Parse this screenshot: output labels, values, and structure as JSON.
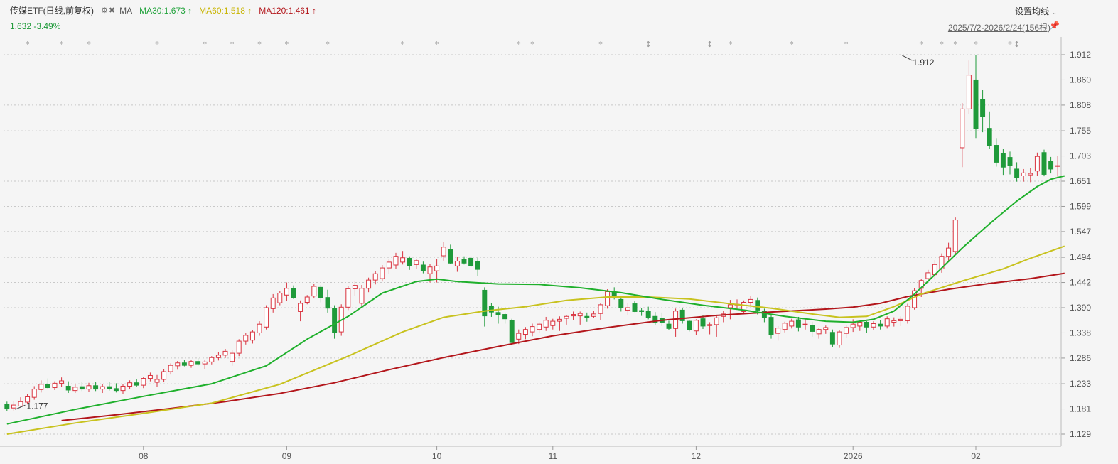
{
  "header": {
    "title": "传媒ETF(日线,前复权)",
    "indicator": "MA",
    "ma30_label": "MA30:1.673",
    "ma30_arrow": "↑",
    "ma60_label": "MA60:1.518",
    "ma60_arrow": "↑",
    "ma120_label": "MA120:1.461",
    "ma120_arrow": "↑",
    "price_line": "1.632  -3.49%",
    "settings_label": "设置均线",
    "date_range": "2025/7/2-2026/2/24(156根)"
  },
  "colors": {
    "up": "#d9333f",
    "down": "#1f9a3a",
    "ma30": "#1fb02c",
    "ma60": "#c8c21e",
    "ma120": "#b3161b",
    "grid": "#c8c8c8"
  },
  "icons": [
    "gear-icon",
    "close-circle-icon",
    "chevron-down-icon",
    "pin-icon",
    "star-icon"
  ],
  "chart_data": {
    "type": "candlestick",
    "y_axis": {
      "ticks": [
        "1.912",
        "1.860",
        "1.808",
        "1.755",
        "1.703",
        "1.651",
        "1.599",
        "1.547",
        "1.494",
        "1.442",
        "1.390",
        "1.338",
        "1.286",
        "1.233",
        "1.181",
        "1.129"
      ],
      "min": 1.129,
      "max": 1.912
    },
    "x_axis_labels": [
      {
        "label": "08",
        "index": 20
      },
      {
        "label": "09",
        "index": 41
      },
      {
        "label": "10",
        "index": 63
      },
      {
        "label": "11",
        "index": 80
      },
      {
        "label": "12",
        "index": 101
      },
      {
        "label": "2026",
        "index": 124
      },
      {
        "label": "02",
        "index": 142
      }
    ],
    "annotations": [
      {
        "text": "1.912",
        "index": 131,
        "value": 1.912,
        "kind": "high"
      },
      {
        "text": "1.177",
        "index": 1,
        "value": 1.177,
        "kind": "low"
      }
    ],
    "event_markers": [
      {
        "index": 3,
        "symbol": "*"
      },
      {
        "index": 8,
        "symbol": "*"
      },
      {
        "index": 12,
        "symbol": "*"
      },
      {
        "index": 22,
        "symbol": "*"
      },
      {
        "index": 29,
        "symbol": "*"
      },
      {
        "index": 33,
        "symbol": "*"
      },
      {
        "index": 37,
        "symbol": "*"
      },
      {
        "index": 41,
        "symbol": "*"
      },
      {
        "index": 47,
        "symbol": "*"
      },
      {
        "index": 58,
        "symbol": "*"
      },
      {
        "index": 63,
        "symbol": "*"
      },
      {
        "index": 75,
        "symbol": "*"
      },
      {
        "index": 77,
        "symbol": "*"
      },
      {
        "index": 87,
        "symbol": "*"
      },
      {
        "index": 94,
        "symbol": "↕"
      },
      {
        "index": 103,
        "symbol": "↕"
      },
      {
        "index": 106,
        "symbol": "*"
      },
      {
        "index": 115,
        "symbol": "*"
      },
      {
        "index": 123,
        "symbol": "*"
      },
      {
        "index": 134,
        "symbol": "*"
      },
      {
        "index": 137,
        "symbol": "*"
      },
      {
        "index": 139,
        "symbol": "*"
      },
      {
        "index": 142,
        "symbol": "*"
      },
      {
        "index": 147,
        "symbol": "*"
      },
      {
        "index": 148,
        "symbol": "↕"
      }
    ],
    "candles": [
      [
        1.19,
        1.196,
        1.176,
        1.181
      ],
      [
        1.183,
        1.198,
        1.177,
        1.189
      ],
      [
        1.187,
        1.205,
        1.184,
        1.196
      ],
      [
        1.195,
        1.212,
        1.191,
        1.206
      ],
      [
        1.205,
        1.228,
        1.2,
        1.222
      ],
      [
        1.221,
        1.24,
        1.215,
        1.232
      ],
      [
        1.232,
        1.244,
        1.222,
        1.225
      ],
      [
        1.225,
        1.238,
        1.22,
        1.234
      ],
      [
        1.234,
        1.246,
        1.226,
        1.239
      ],
      [
        1.228,
        1.238,
        1.214,
        1.22
      ],
      [
        1.219,
        1.232,
        1.214,
        1.226
      ],
      [
        1.227,
        1.236,
        1.218,
        1.222
      ],
      [
        1.222,
        1.235,
        1.216,
        1.229
      ],
      [
        1.229,
        1.236,
        1.218,
        1.222
      ],
      [
        1.222,
        1.233,
        1.214,
        1.227
      ],
      [
        1.227,
        1.236,
        1.219,
        1.223
      ],
      [
        1.223,
        1.234,
        1.215,
        1.219
      ],
      [
        1.219,
        1.232,
        1.212,
        1.228
      ],
      [
        1.228,
        1.24,
        1.222,
        1.235
      ],
      [
        1.235,
        1.243,
        1.226,
        1.23
      ],
      [
        1.23,
        1.247,
        1.224,
        1.244
      ],
      [
        1.244,
        1.256,
        1.238,
        1.25
      ],
      [
        1.236,
        1.251,
        1.227,
        1.242
      ],
      [
        1.242,
        1.263,
        1.236,
        1.258
      ],
      [
        1.258,
        1.275,
        1.252,
        1.271
      ],
      [
        1.27,
        1.28,
        1.262,
        1.276
      ],
      [
        1.276,
        1.282,
        1.269,
        1.271
      ],
      [
        1.271,
        1.283,
        1.266,
        1.279
      ],
      [
        1.279,
        1.286,
        1.27,
        1.274
      ],
      [
        1.274,
        1.283,
        1.263,
        1.278
      ],
      [
        1.278,
        1.29,
        1.273,
        1.287
      ],
      [
        1.287,
        1.298,
        1.281,
        1.292
      ],
      [
        1.292,
        1.305,
        1.286,
        1.3
      ],
      [
        1.279,
        1.302,
        1.27,
        1.296
      ],
      [
        1.296,
        1.325,
        1.29,
        1.321
      ],
      [
        1.321,
        1.338,
        1.314,
        1.333
      ],
      [
        1.323,
        1.344,
        1.316,
        1.34
      ],
      [
        1.338,
        1.362,
        1.332,
        1.356
      ],
      [
        1.35,
        1.395,
        1.345,
        1.39
      ],
      [
        1.388,
        1.418,
        1.38,
        1.41
      ],
      [
        1.4,
        1.424,
        1.395,
        1.42
      ],
      [
        1.416,
        1.442,
        1.404,
        1.43
      ],
      [
        1.43,
        1.436,
        1.408,
        1.411
      ],
      [
        1.382,
        1.405,
        1.362,
        1.399
      ],
      [
        1.401,
        1.416,
        1.397,
        1.412
      ],
      [
        1.414,
        1.439,
        1.409,
        1.434
      ],
      [
        1.432,
        1.437,
        1.401,
        1.41
      ],
      [
        1.411,
        1.427,
        1.38,
        1.389
      ],
      [
        1.389,
        1.395,
        1.326,
        1.338
      ],
      [
        1.34,
        1.397,
        1.332,
        1.391
      ],
      [
        1.391,
        1.434,
        1.385,
        1.429
      ],
      [
        1.429,
        1.444,
        1.415,
        1.436
      ],
      [
        1.399,
        1.437,
        1.391,
        1.43
      ],
      [
        1.43,
        1.452,
        1.422,
        1.447
      ],
      [
        1.447,
        1.466,
        1.438,
        1.46
      ],
      [
        1.45,
        1.478,
        1.444,
        1.472
      ],
      [
        1.472,
        1.49,
        1.46,
        1.484
      ],
      [
        1.478,
        1.503,
        1.47,
        1.496
      ],
      [
        1.484,
        1.507,
        1.479,
        1.493
      ],
      [
        1.492,
        1.496,
        1.468,
        1.476
      ],
      [
        1.479,
        1.491,
        1.47,
        1.487
      ],
      [
        1.478,
        1.485,
        1.461,
        1.467
      ],
      [
        1.46,
        1.48,
        1.442,
        1.474
      ],
      [
        1.466,
        1.49,
        1.442,
        1.476
      ],
      [
        1.497,
        1.525,
        1.487,
        1.515
      ],
      [
        1.51,
        1.52,
        1.48,
        1.482
      ],
      [
        1.476,
        1.495,
        1.464,
        1.486
      ],
      [
        1.489,
        1.496,
        1.479,
        1.482
      ],
      [
        1.492,
        1.496,
        1.474,
        1.476
      ],
      [
        1.486,
        1.493,
        1.456,
        1.469
      ],
      [
        1.426,
        1.432,
        1.351,
        1.373
      ],
      [
        1.393,
        1.4,
        1.371,
        1.381
      ],
      [
        1.38,
        1.392,
        1.357,
        1.376
      ],
      [
        1.376,
        1.38,
        1.357,
        1.367
      ],
      [
        1.363,
        1.367,
        1.313,
        1.318
      ],
      [
        1.325,
        1.345,
        1.315,
        1.337
      ],
      [
        1.335,
        1.35,
        1.325,
        1.345
      ],
      [
        1.34,
        1.357,
        1.331,
        1.351
      ],
      [
        1.345,
        1.36,
        1.338,
        1.356
      ],
      [
        1.35,
        1.371,
        1.342,
        1.364
      ],
      [
        1.353,
        1.367,
        1.345,
        1.362
      ],
      [
        1.362,
        1.372,
        1.342,
        1.366
      ],
      [
        1.368,
        1.375,
        1.355,
        1.372
      ],
      [
        1.373,
        1.382,
        1.364,
        1.376
      ],
      [
        1.373,
        1.382,
        1.355,
        1.378
      ],
      [
        1.372,
        1.38,
        1.361,
        1.37
      ],
      [
        1.372,
        1.384,
        1.368,
        1.377
      ],
      [
        1.378,
        1.399,
        1.364,
        1.396
      ],
      [
        1.394,
        1.428,
        1.388,
        1.423
      ],
      [
        1.422,
        1.432,
        1.407,
        1.41
      ],
      [
        1.407,
        1.412,
        1.382,
        1.39
      ],
      [
        1.385,
        1.399,
        1.374,
        1.39
      ],
      [
        1.398,
        1.403,
        1.381,
        1.382
      ],
      [
        1.384,
        1.389,
        1.373,
        1.382
      ],
      [
        1.382,
        1.392,
        1.366,
        1.369
      ],
      [
        1.372,
        1.381,
        1.355,
        1.359
      ],
      [
        1.368,
        1.38,
        1.352,
        1.36
      ],
      [
        1.356,
        1.363,
        1.344,
        1.347
      ],
      [
        1.347,
        1.388,
        1.33,
        1.383
      ],
      [
        1.385,
        1.39,
        1.357,
        1.363
      ],
      [
        1.362,
        1.365,
        1.341,
        1.345
      ],
      [
        1.342,
        1.366,
        1.333,
        1.364
      ],
      [
        1.367,
        1.375,
        1.346,
        1.352
      ],
      [
        1.353,
        1.36,
        1.335,
        1.355
      ],
      [
        1.355,
        1.375,
        1.33,
        1.369
      ],
      [
        1.372,
        1.383,
        1.36,
        1.377
      ],
      [
        1.39,
        1.406,
        1.366,
        1.396
      ],
      [
        1.396,
        1.407,
        1.388,
        1.397
      ],
      [
        1.382,
        1.405,
        1.376,
        1.401
      ],
      [
        1.401,
        1.414,
        1.393,
        1.407
      ],
      [
        1.405,
        1.411,
        1.376,
        1.385
      ],
      [
        1.382,
        1.388,
        1.36,
        1.37
      ],
      [
        1.37,
        1.375,
        1.326,
        1.335
      ],
      [
        1.337,
        1.352,
        1.322,
        1.348
      ],
      [
        1.345,
        1.361,
        1.339,
        1.358
      ],
      [
        1.352,
        1.367,
        1.347,
        1.362
      ],
      [
        1.365,
        1.371,
        1.341,
        1.35
      ],
      [
        1.355,
        1.366,
        1.345,
        1.356
      ],
      [
        1.354,
        1.361,
        1.33,
        1.341
      ],
      [
        1.336,
        1.348,
        1.326,
        1.345
      ],
      [
        1.345,
        1.353,
        1.336,
        1.349
      ],
      [
        1.339,
        1.345,
        1.308,
        1.315
      ],
      [
        1.313,
        1.344,
        1.307,
        1.34
      ],
      [
        1.337,
        1.354,
        1.327,
        1.349
      ],
      [
        1.349,
        1.366,
        1.34,
        1.356
      ],
      [
        1.352,
        1.362,
        1.342,
        1.36
      ],
      [
        1.36,
        1.362,
        1.338,
        1.35
      ],
      [
        1.35,
        1.362,
        1.343,
        1.357
      ],
      [
        1.356,
        1.364,
        1.345,
        1.352
      ],
      [
        1.352,
        1.372,
        1.347,
        1.367
      ],
      [
        1.36,
        1.37,
        1.351,
        1.363
      ],
      [
        1.363,
        1.372,
        1.352,
        1.366
      ],
      [
        1.363,
        1.398,
        1.357,
        1.393
      ],
      [
        1.39,
        1.431,
        1.386,
        1.425
      ],
      [
        1.43,
        1.449,
        1.412,
        1.446
      ],
      [
        1.45,
        1.468,
        1.444,
        1.462
      ],
      [
        1.458,
        1.488,
        1.448,
        1.479
      ],
      [
        1.47,
        1.502,
        1.462,
        1.496
      ],
      [
        1.496,
        1.524,
        1.484,
        1.513
      ],
      [
        1.506,
        1.576,
        1.5,
        1.571
      ],
      [
        1.72,
        1.812,
        1.68,
        1.8
      ],
      [
        1.8,
        1.9,
        1.79,
        1.87
      ],
      [
        1.86,
        1.912,
        1.74,
        1.76
      ],
      [
        1.82,
        1.84,
        1.752,
        1.785
      ],
      [
        1.76,
        1.795,
        1.718,
        1.725
      ],
      [
        1.725,
        1.74,
        1.681,
        1.69
      ],
      [
        1.708,
        1.718,
        1.664,
        1.68
      ],
      [
        1.7,
        1.712,
        1.665,
        1.684
      ],
      [
        1.676,
        1.69,
        1.65,
        1.658
      ],
      [
        1.662,
        1.676,
        1.65,
        1.668
      ],
      [
        1.664,
        1.678,
        1.649,
        1.667
      ],
      [
        1.672,
        1.71,
        1.662,
        1.702
      ],
      [
        1.71,
        1.716,
        1.661,
        1.665
      ],
      [
        1.692,
        1.701,
        1.667,
        1.676
      ],
      [
        1.683,
        1.703,
        1.66,
        1.683
      ]
    ],
    "ma30": [
      [
        0,
        1.15
      ],
      [
        10,
        1.18
      ],
      [
        20,
        1.207
      ],
      [
        30,
        1.233
      ],
      [
        38,
        1.27
      ],
      [
        44,
        1.325
      ],
      [
        50,
        1.372
      ],
      [
        55,
        1.42
      ],
      [
        60,
        1.444
      ],
      [
        63,
        1.449
      ],
      [
        66,
        1.444
      ],
      [
        72,
        1.439
      ],
      [
        78,
        1.438
      ],
      [
        84,
        1.431
      ],
      [
        90,
        1.421
      ],
      [
        96,
        1.407
      ],
      [
        102,
        1.395
      ],
      [
        108,
        1.385
      ],
      [
        114,
        1.372
      ],
      [
        120,
        1.362
      ],
      [
        124,
        1.36
      ],
      [
        127,
        1.366
      ],
      [
        130,
        1.383
      ],
      [
        133,
        1.418
      ],
      [
        136,
        1.458
      ],
      [
        140,
        1.513
      ],
      [
        144,
        1.563
      ],
      [
        148,
        1.61
      ],
      [
        151,
        1.64
      ],
      [
        153,
        1.655
      ],
      [
        155,
        1.662
      ]
    ],
    "ma60": [
      [
        0,
        1.129
      ],
      [
        10,
        1.152
      ],
      [
        20,
        1.172
      ],
      [
        30,
        1.193
      ],
      [
        40,
        1.232
      ],
      [
        50,
        1.29
      ],
      [
        58,
        1.34
      ],
      [
        64,
        1.37
      ],
      [
        70,
        1.383
      ],
      [
        76,
        1.392
      ],
      [
        82,
        1.405
      ],
      [
        88,
        1.412
      ],
      [
        94,
        1.412
      ],
      [
        100,
        1.408
      ],
      [
        106,
        1.398
      ],
      [
        112,
        1.389
      ],
      [
        118,
        1.377
      ],
      [
        122,
        1.37
      ],
      [
        126,
        1.372
      ],
      [
        130,
        1.392
      ],
      [
        134,
        1.418
      ],
      [
        140,
        1.445
      ],
      [
        146,
        1.47
      ],
      [
        150,
        1.492
      ],
      [
        155,
        1.517
      ]
    ],
    "ma120": [
      [
        8,
        1.157
      ],
      [
        16,
        1.169
      ],
      [
        24,
        1.182
      ],
      [
        32,
        1.196
      ],
      [
        40,
        1.213
      ],
      [
        48,
        1.235
      ],
      [
        56,
        1.262
      ],
      [
        64,
        1.287
      ],
      [
        72,
        1.31
      ],
      [
        80,
        1.332
      ],
      [
        88,
        1.349
      ],
      [
        96,
        1.364
      ],
      [
        104,
        1.374
      ],
      [
        112,
        1.381
      ],
      [
        120,
        1.387
      ],
      [
        124,
        1.391
      ],
      [
        128,
        1.399
      ],
      [
        132,
        1.413
      ],
      [
        138,
        1.428
      ],
      [
        144,
        1.44
      ],
      [
        150,
        1.45
      ],
      [
        155,
        1.461
      ]
    ]
  }
}
